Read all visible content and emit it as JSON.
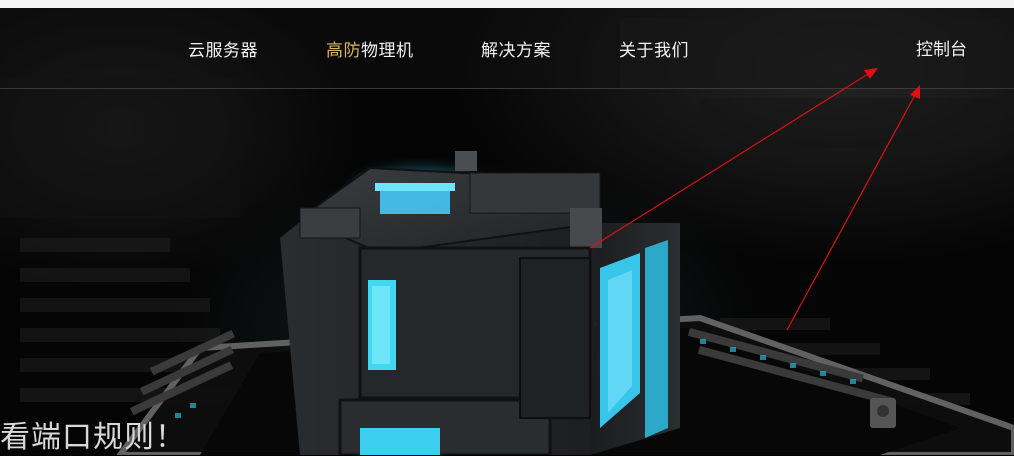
{
  "nav": {
    "items": [
      {
        "label": "云服务器"
      },
      {
        "label_highlight": "高防",
        "label_rest": "物理机"
      },
      {
        "label": "解决方案"
      },
      {
        "label": "关于我们"
      }
    ],
    "console": "控制台"
  },
  "hero": {
    "headline": "看端口规则！"
  },
  "colors": {
    "highlight": "#d9b56a",
    "annotation_arrow": "#e01010",
    "glow": "#38d6ff"
  }
}
